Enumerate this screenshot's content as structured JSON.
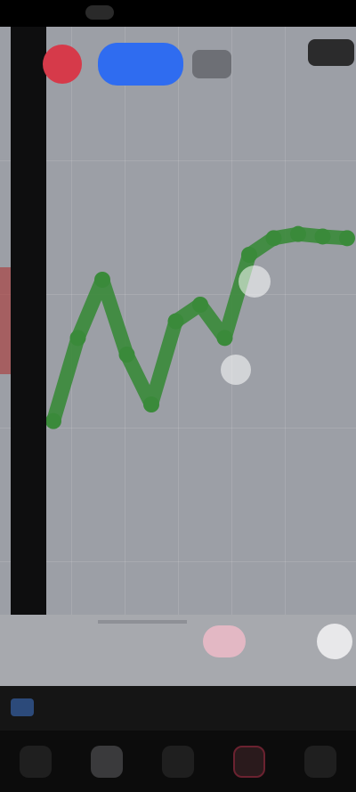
{
  "status": {
    "time": ""
  },
  "toolbar": {
    "primary_action": "",
    "secondary_action": "",
    "mode": "",
    "menu": ""
  },
  "chart_data": {
    "type": "line",
    "series": [
      {
        "values": [
          140,
          240,
          310,
          220,
          160,
          260,
          280,
          240,
          340,
          360,
          365,
          362,
          360
        ]
      }
    ],
    "colors": {
      "line": "#3a8a3a",
      "background": "#9c9fa6"
    }
  },
  "info_bar": {
    "left_text": "",
    "right_text": ""
  },
  "nav": {
    "items": [
      {
        "icon": "chart-icon"
      },
      {
        "icon": "home-icon"
      },
      {
        "icon": "list-icon"
      },
      {
        "icon": "bell-icon"
      },
      {
        "icon": "menu-icon"
      }
    ]
  }
}
